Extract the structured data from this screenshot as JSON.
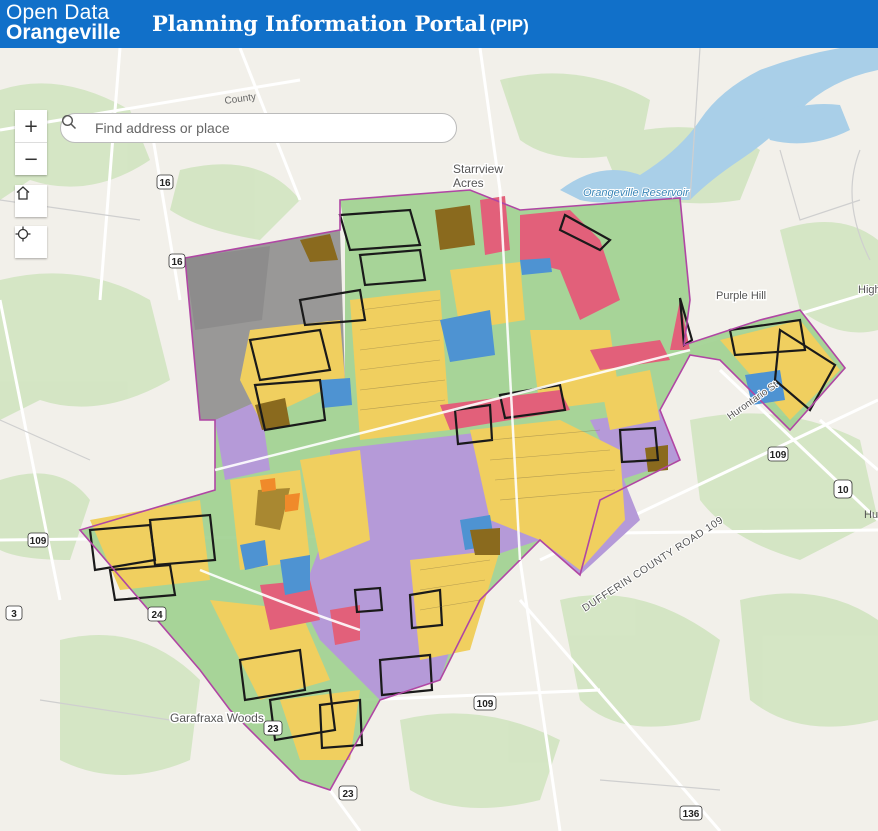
{
  "header": {
    "logo_line1": "Open Data",
    "logo_line2": "Orangeville",
    "title": "Planning Information Portal",
    "subtitle": "(PIP)",
    "background": "#1170c9"
  },
  "controls": {
    "zoom_in": "+",
    "zoom_out": "−",
    "home_icon": "home-icon",
    "locate_icon": "locate-icon"
  },
  "search": {
    "placeholder": "Find address or place",
    "value": ""
  },
  "map_labels": {
    "starrview_1": "Starrview",
    "starrview_2": "Acres",
    "reservoir": "Orangeville Reservoir",
    "purple_hill": "Purple Hill",
    "garafraxa": "Garafraxa Woods",
    "dufferin_road": "DUFFERIN COUNTY ROAD 109",
    "county_road": "County",
    "highway": "High",
    "hu": "Hu",
    "hurontario": "Hurontario St"
  },
  "route_shields": [
    "16",
    "16",
    "109",
    "109",
    "109",
    "10",
    "3",
    "23",
    "23",
    "136",
    "24"
  ],
  "palette": {
    "residential": "#f0cf5f",
    "commercial": "#e2607a",
    "institutional": "#b29ad6",
    "open_space": "#9ed08f",
    "industrial": "#8a6a1e",
    "water": "#4e93d2",
    "rural": "#7a7a7a",
    "boundary": "#b046a4"
  }
}
